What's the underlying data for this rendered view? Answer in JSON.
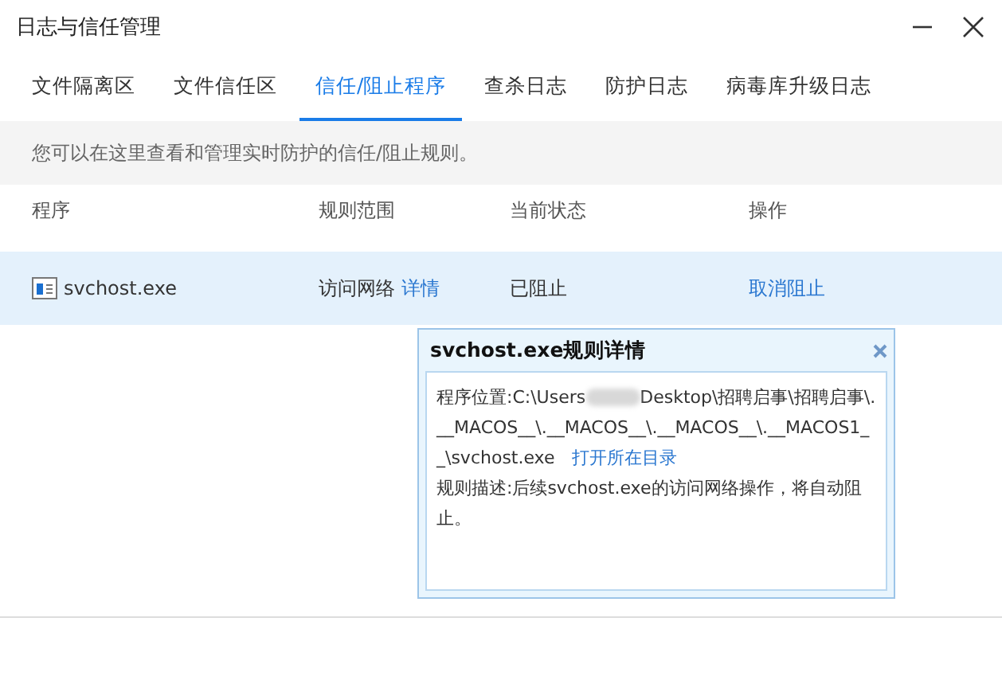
{
  "window": {
    "title": "日志与信任管理"
  },
  "tabs": [
    {
      "label": "文件隔离区",
      "selected": false
    },
    {
      "label": "文件信任区",
      "selected": false
    },
    {
      "label": "信任/阻止程序",
      "selected": true
    },
    {
      "label": "查杀日志",
      "selected": false
    },
    {
      "label": "防护日志",
      "selected": false
    },
    {
      "label": "病毒库升级日志",
      "selected": false
    }
  ],
  "info": "您可以在这里查看和管理实时防护的信任/阻止规则。",
  "table": {
    "columns": [
      "程序",
      "规则范围",
      "当前状态",
      "操作"
    ],
    "rows": [
      {
        "program": "svchost.exe",
        "scope": "访问网络",
        "details_link": "详情",
        "status": "已阻止",
        "action": "取消阻止",
        "selected": true
      }
    ]
  },
  "popup": {
    "title": "svchost.exe规则详情",
    "location_label": "程序位置:",
    "path_before": "C:\\Users",
    "path_redacted": true,
    "path_after": "Desktop\\招聘启事\\招聘启事\\.__MACOS__\\.__MACOS__\\.__MACOS__\\.__MACOS1__\\svchost.exe",
    "open_folder_link": "打开所在目录",
    "description": "规则描述:后续svchost.exe的访问网络操作，将自动阻止。"
  }
}
